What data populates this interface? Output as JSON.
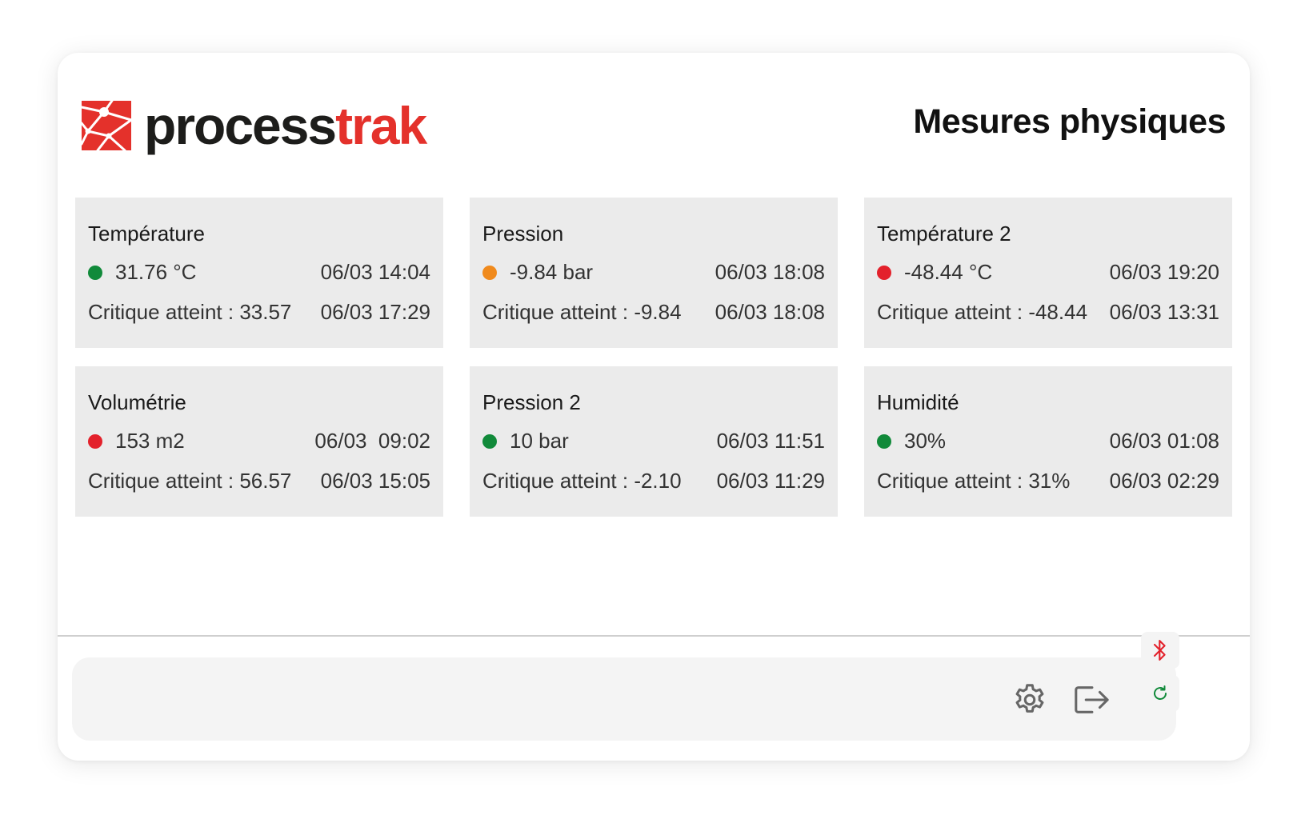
{
  "header": {
    "logo_dark": "process",
    "logo_red": "trak",
    "title": "Mesures physiques"
  },
  "cards": [
    {
      "title": "Température",
      "value": "31.76 °C",
      "time": "06/03 14:04",
      "critical": "Critique atteint : 33.57",
      "critical_time": "06/03 17:29",
      "status_color": "#118a3a"
    },
    {
      "title": "Pression",
      "value": "-9.84 bar",
      "time": "06/03 18:08",
      "critical": "Critique atteint : -9.84",
      "critical_time": "06/03 18:08",
      "status_color": "#f08a1c"
    },
    {
      "title": "Température 2",
      "value": "-48.44 °C",
      "time": "06/03 19:20",
      "critical": "Critique atteint : -48.44",
      "critical_time": "06/03 13:31",
      "status_color": "#e3212b"
    },
    {
      "title": "Volumétrie",
      "value": "153 m2",
      "time": "06/03  09:02",
      "critical": "Critique atteint : 56.57",
      "critical_time": "06/03 15:05",
      "status_color": "#e3212b"
    },
    {
      "title": "Pression 2",
      "value": "10 bar",
      "time": "06/03 11:51",
      "critical": "Critique atteint : -2.10",
      "critical_time": "06/03 11:29",
      "status_color": "#118a3a"
    },
    {
      "title": "Humidité",
      "value": "30%",
      "time": "06/03 01:08",
      "critical": "Critique atteint : 31%",
      "critical_time": "06/03 02:29",
      "status_color": "#118a3a"
    }
  ],
  "toolbar": {
    "settings_icon": "gear-icon",
    "logout_icon": "logout-icon",
    "bluetooth_icon": "bluetooth-icon",
    "bluetooth_color": "#e3212b",
    "refresh_icon": "refresh-icon",
    "refresh_color": "#118a3a"
  },
  "colors": {
    "brand_red": "#e4312b",
    "card_bg": "#ebebeb"
  }
}
